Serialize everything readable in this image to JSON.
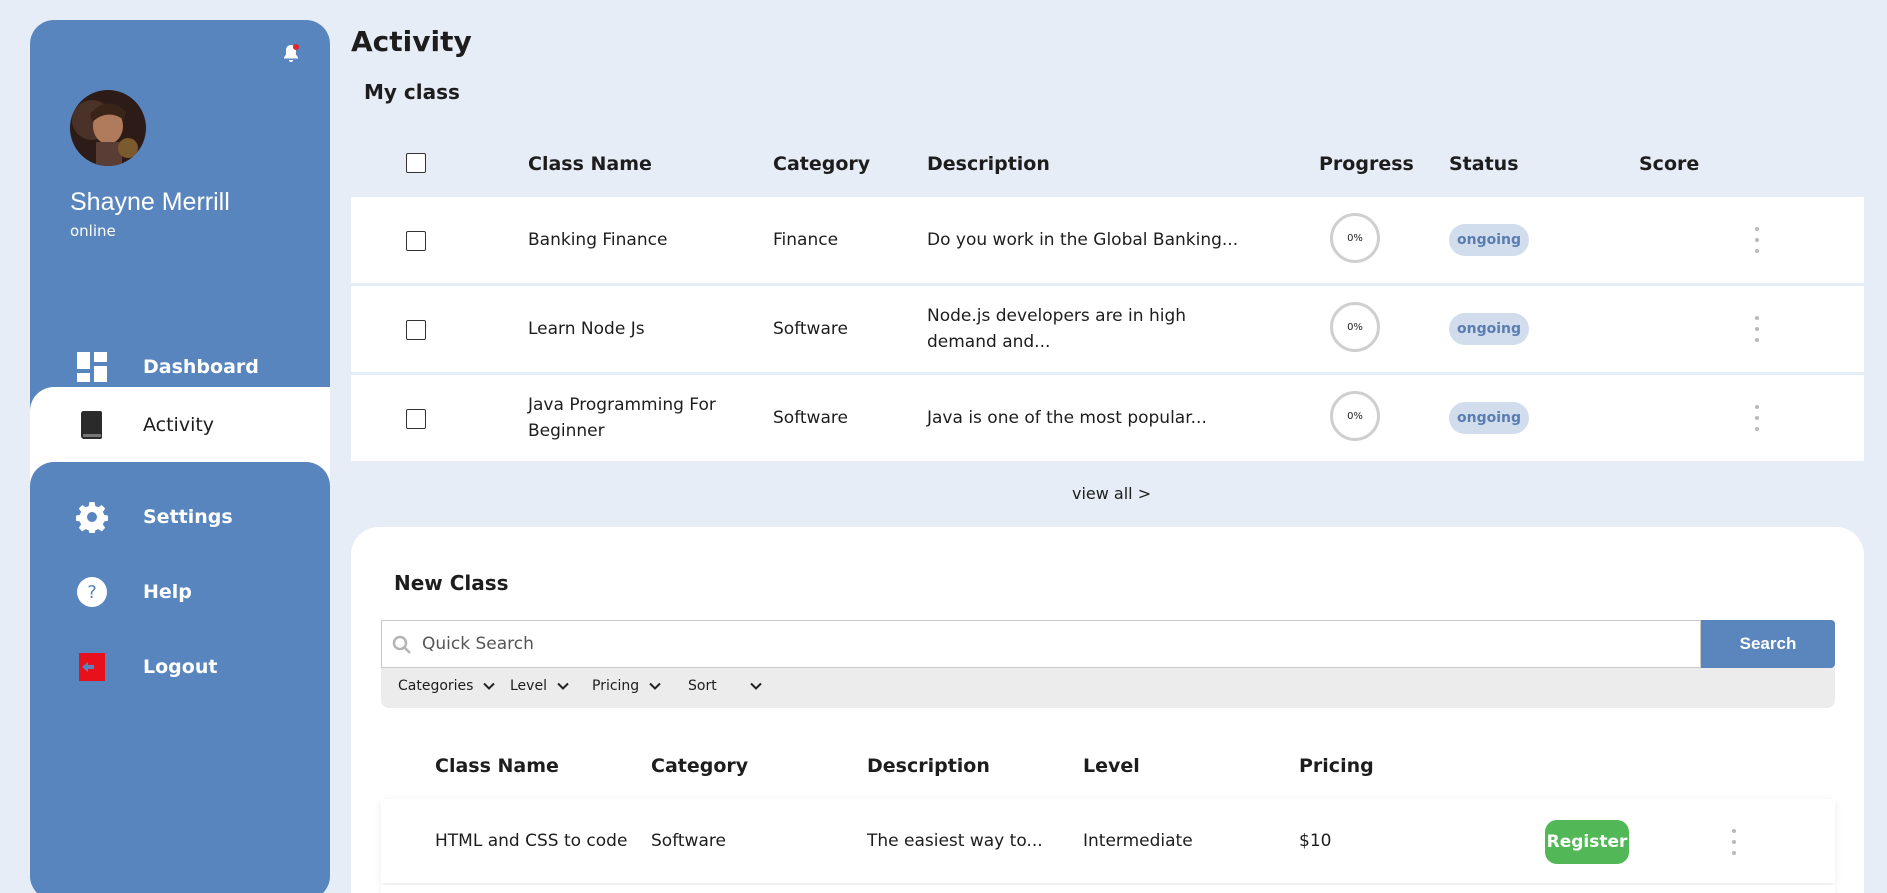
{
  "user": {
    "name": "Shayne Merrill",
    "status": "online"
  },
  "nav": [
    {
      "label": "Dashboard",
      "icon": "dashboard-icon"
    },
    {
      "label": "Activity",
      "icon": "book-icon",
      "active": true
    },
    {
      "label": "Settings",
      "icon": "gear-icon"
    },
    {
      "label": "Help",
      "icon": "help-icon"
    },
    {
      "label": "Logout",
      "icon": "logout-icon"
    }
  ],
  "page": {
    "title": "Activity",
    "section": "My class"
  },
  "my_class": {
    "headers": [
      "Class Name",
      "Category",
      "Description",
      "Progress",
      "Status",
      "Score"
    ],
    "rows": [
      {
        "name": "Banking Finance",
        "category": "Finance",
        "description": "Do you work in the Global Banking...",
        "progress": "0%",
        "status": "ongoing"
      },
      {
        "name": "Learn Node Js",
        "category": "Software",
        "description": "Node.js developers are in high demand and...",
        "progress": "0%",
        "status": "ongoing"
      },
      {
        "name": "Java Programming For Beginner",
        "category": "Software",
        "description": "Java is one of the most popular...",
        "progress": "0%",
        "status": "ongoing"
      }
    ],
    "view_all": "view all >"
  },
  "new_class": {
    "title": "New Class",
    "search": {
      "placeholder": "Quick Search",
      "button": "Search"
    },
    "filters": [
      "Categories",
      "Level",
      "Pricing",
      "Sort"
    ],
    "headers": [
      "Class Name",
      "Category",
      "Description",
      "Level",
      "Pricing"
    ],
    "rows": [
      {
        "name": "HTML and CSS to code",
        "category": "Software",
        "description": "The easiest way to...",
        "level": "Intermediate",
        "pricing": "$10",
        "action": "Register"
      }
    ]
  },
  "colors": {
    "sidebar": "#5885bd",
    "background": "#e7edf6",
    "badge_bg": "#d1ddec",
    "badge_text": "#5a7db1",
    "register": "#51b757",
    "notification_dot": "#e0252b"
  }
}
